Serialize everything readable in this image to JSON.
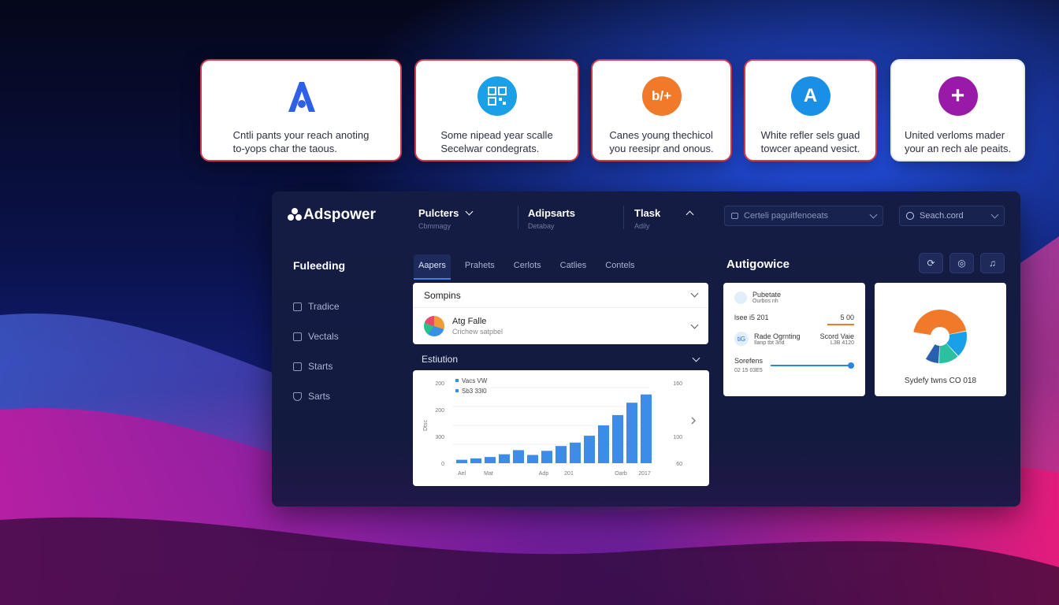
{
  "feature_cards": [
    {
      "icon": "letter-a-icon",
      "glyph": "A",
      "color": "#2f5fe6",
      "line1": "Cntli pants your reach anoting",
      "line2": "to-yops char the taous."
    },
    {
      "icon": "qr-code-icon",
      "glyph": "",
      "color": "#1aa0e6",
      "line1": "Some nipead year scalle",
      "line2": "Secelwar condegrats."
    },
    {
      "icon": "by-plus-icon",
      "glyph": "b/+",
      "color": "#f07a2a",
      "line1": "Canes young thechicol",
      "line2": "you reesipr and onous."
    },
    {
      "icon": "letter-a-circle-icon",
      "glyph": "A",
      "color": "#1a8fe6",
      "line1": "White refler sels guad",
      "line2": "towcer apeand vesict."
    },
    {
      "icon": "plus-icon",
      "glyph": "+",
      "color": "#9a1aa8",
      "line1": "United verloms mader",
      "line2": "your an rech ale peaits."
    }
  ],
  "app": {
    "name": "Adspower"
  },
  "topnav": [
    {
      "title": "Pulcters",
      "sub": "Cbmmagy"
    },
    {
      "title": "Adipsarts",
      "sub": "Detabay"
    },
    {
      "title": "Tlask",
      "sub": "Adily"
    }
  ],
  "filter_select": {
    "value": "Certeli paguitfenoeats"
  },
  "search": {
    "placeholder": "Seach.cord"
  },
  "sidebar": {
    "heading": "Fuleeding",
    "items": [
      {
        "label": "Tradice",
        "icon": "list-icon"
      },
      {
        "label": "Vectals",
        "icon": "grid-icon"
      },
      {
        "label": "Starts",
        "icon": "chart-icon"
      },
      {
        "label": "Sarts",
        "icon": "shield-icon"
      }
    ]
  },
  "tabs": [
    "Aapers",
    "Prahets",
    "Cerlots",
    "Catlies",
    "Contels"
  ],
  "accordion": {
    "title": "Sompins",
    "user_name": "Atg Falle",
    "user_sub": "Crichew satpbel"
  },
  "estimation": {
    "title": "Estiution"
  },
  "chart_data": {
    "type": "bar",
    "legend": [
      "Vacs VW",
      "Sb3 33l0"
    ],
    "y_ticks_left": [
      "200",
      "200",
      "300",
      "0"
    ],
    "y_ticks_right": [
      "160",
      "100",
      "60"
    ],
    "ylabel": "Dtsc",
    "x_ticks": [
      "Ael",
      "Mat",
      "Adp",
      "201",
      "Oarb",
      "2017"
    ],
    "values": [
      5,
      7,
      9,
      13,
      19,
      12,
      18,
      25,
      30,
      40,
      55,
      70,
      88,
      100
    ],
    "ylim": [
      0,
      110
    ],
    "color": "#3d8de8"
  },
  "right_panel": {
    "title": "Autigowice",
    "buttons": [
      "refresh-icon",
      "target-icon",
      "bell-icon"
    ],
    "card1": {
      "row1_title": "Pubetate",
      "row1_sub": "Ourbos nh",
      "row2_left": "lsee i5 201",
      "row2_right": "5 00",
      "row3_icon": "tiG",
      "row3_title": "Rade Ogrnting",
      "row3_sub": "Ilanp tbt 3nd",
      "row3_right1": "Scord Vaie",
      "row3_right2": "L3B 4120",
      "row4_title": "Sorefens",
      "row4_sub": "02 15 03E5",
      "slider_value": 1.0
    },
    "card2": {
      "caption": "Sydefy twns CO 018",
      "donut": [
        {
          "color": "#f07a2a",
          "value": 55
        },
        {
          "color": "#1aa0e6",
          "value": 20
        },
        {
          "color": "#2ac0a0",
          "value": 15
        },
        {
          "color": "#2a5fb0",
          "value": 10
        }
      ]
    }
  }
}
